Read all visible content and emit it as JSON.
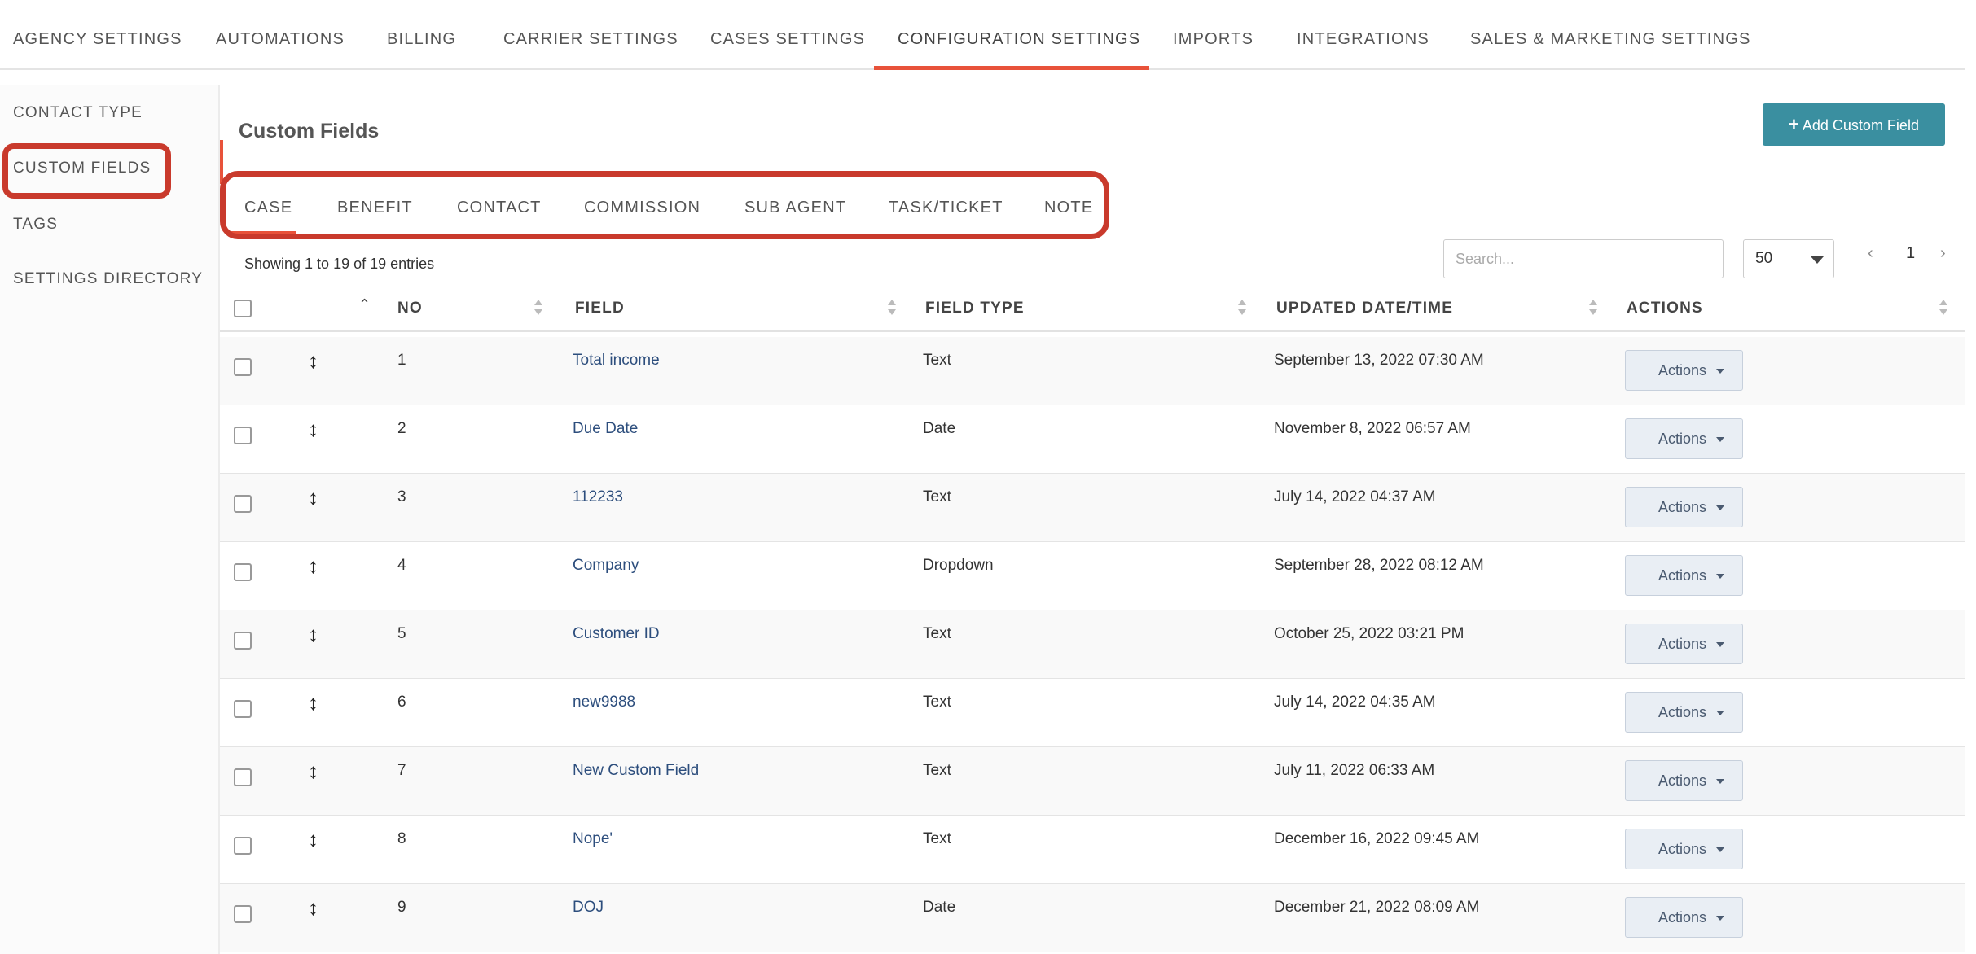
{
  "topnav": {
    "items": [
      {
        "label": "AGENCY SETTINGS"
      },
      {
        "label": "AUTOMATIONS"
      },
      {
        "label": "BILLING"
      },
      {
        "label": "CARRIER SETTINGS"
      },
      {
        "label": "CASES SETTINGS"
      },
      {
        "label": "CONFIGURATION SETTINGS"
      },
      {
        "label": "IMPORTS"
      },
      {
        "label": "INTEGRATIONS"
      },
      {
        "label": "SALES & MARKETING SETTINGS"
      }
    ],
    "active_index": 5
  },
  "sidebar": {
    "items": [
      {
        "label": "CONTACT TYPE"
      },
      {
        "label": "CUSTOM FIELDS"
      },
      {
        "label": "TAGS"
      },
      {
        "label": "SETTINGS DIRECTORY"
      }
    ],
    "active_index": 1
  },
  "main": {
    "title": "Custom Fields",
    "add_button": "Add Custom Field",
    "tabs": [
      {
        "label": "CASE"
      },
      {
        "label": "BENEFIT"
      },
      {
        "label": "CONTACT"
      },
      {
        "label": "COMMISSION"
      },
      {
        "label": "SUB AGENT"
      },
      {
        "label": "TASK/TICKET"
      },
      {
        "label": "NOTE"
      }
    ],
    "active_tab_index": 0,
    "entries_text": "Showing 1 to 19 of 19 entries",
    "search_placeholder": "Search...",
    "page_size": "50",
    "current_page": "1",
    "prev_glyph": "‹",
    "next_glyph": "›"
  },
  "table": {
    "columns": {
      "no": "NO",
      "field": "FIELD",
      "field_type": "FIELD TYPE",
      "updated": "UPDATED DATE/TIME",
      "actions": "ACTIONS"
    },
    "action_label": "Actions",
    "drag_glyph": "↕",
    "rows": [
      {
        "no": "1",
        "field": "Total income",
        "type": "Text",
        "updated": "September 13, 2022 07:30 AM"
      },
      {
        "no": "2",
        "field": "Due Date",
        "type": "Date",
        "updated": "November 8, 2022 06:57 AM"
      },
      {
        "no": "3",
        "field": "112233",
        "type": "Text",
        "updated": "July 14, 2022 04:37 AM"
      },
      {
        "no": "4",
        "field": "Company",
        "type": "Dropdown",
        "updated": "September 28, 2022 08:12 AM"
      },
      {
        "no": "5",
        "field": "Customer ID",
        "type": "Text",
        "updated": "October 25, 2022 03:21 PM"
      },
      {
        "no": "6",
        "field": "new9988",
        "type": "Text",
        "updated": "July 14, 2022 04:35 AM"
      },
      {
        "no": "7",
        "field": "New Custom Field",
        "type": "Text",
        "updated": "July 11, 2022 06:33 AM"
      },
      {
        "no": "8",
        "field": "Nope'",
        "type": "Text",
        "updated": "December 16, 2022 09:45 AM"
      },
      {
        "no": "9",
        "field": "DOJ",
        "type": "Date",
        "updated": "December 21, 2022 08:09 AM"
      }
    ]
  },
  "colors": {
    "accent": "#e8523a",
    "highlight": "#c93a2c",
    "primary_button": "#3a8fa0",
    "link": "#2d4e7d"
  }
}
